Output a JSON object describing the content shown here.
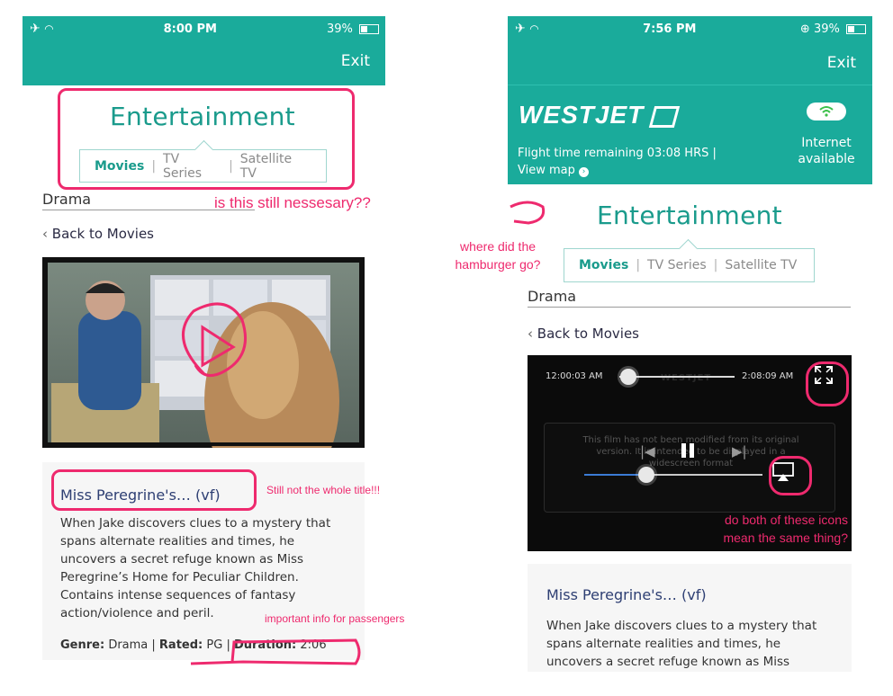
{
  "left": {
    "status": {
      "time": "8:00 PM",
      "battery": "39%"
    },
    "header": {
      "exit_label": "Exit"
    },
    "section_title": "Entertainment",
    "tabs": [
      {
        "label": "Movies",
        "active": true
      },
      {
        "label": "TV Series",
        "active": false
      },
      {
        "label": "Satellite TV",
        "active": false
      }
    ],
    "category": "Drama",
    "back_label": "Back to Movies",
    "movie": {
      "title": "Miss Peregrine's… (vf)",
      "description": "When Jake discovers clues to a mystery that spans alternate realities and times, he uncovers a secret refuge known as Miss Peregrine’s Home for Peculiar Children. Contains intense sequences of fantasy action/violence and peril.",
      "genre_label": "Genre:",
      "genre": "Drama",
      "rated_label": "Rated:",
      "rated": "PG",
      "duration_label": "Duration:",
      "duration": "2:06"
    }
  },
  "right": {
    "status": {
      "time": "7:56 PM",
      "battery": "39%"
    },
    "header": {
      "exit_label": "Exit"
    },
    "brand": "WESTJET",
    "flight_time": "Flight time remaining 03:08 HRS |",
    "view_map": "View map",
    "internet_line1": "Internet",
    "internet_line2": "available",
    "section_title": "Entertainment",
    "tabs": [
      {
        "label": "Movies",
        "active": true
      },
      {
        "label": "TV Series",
        "active": false
      },
      {
        "label": "Satellite TV",
        "active": false
      }
    ],
    "category": "Drama",
    "back_label": "Back to Movies",
    "player": {
      "current_time": "12:00:03 AM",
      "end_time": "2:08:09 AM",
      "progress": 0.08,
      "volume": 0.35,
      "notice": "This film has not been modified from its original version. It is intended to be displayed in a widescreen format",
      "watermark": "WESTJET"
    },
    "movie": {
      "title": "Miss Peregrine's… (vf)",
      "description_lines": [
        "When Jake discovers clues to a mystery that",
        "spans alternate realities and times, he",
        "uncovers a secret refuge known as Miss"
      ]
    }
  },
  "annotations": {
    "necessary": "is this still nessesary??",
    "hamburger_1": "where did the",
    "hamburger_2": "hamburger go?",
    "title": "Still not the whole title!!!",
    "important": "important info for passengers",
    "icons_1": "do both of these icons",
    "icons_2": "mean the same thing?"
  },
  "colors": {
    "teal": "#1aab9b",
    "annotation": "#ee2a6e",
    "title_blue": "#2e3f73"
  }
}
